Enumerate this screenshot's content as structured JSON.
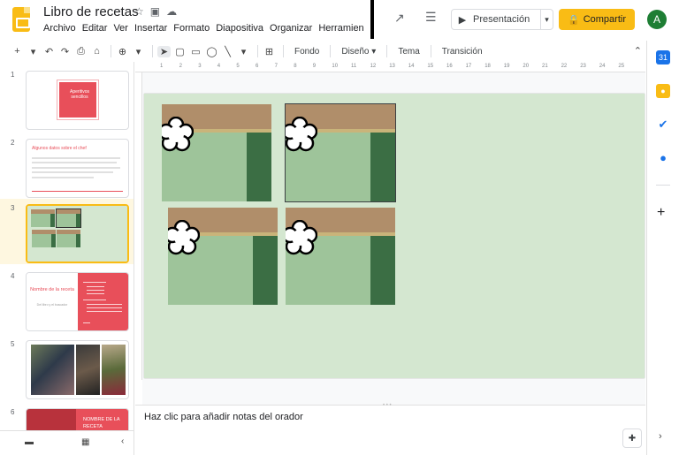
{
  "header": {
    "title": "Libro de recetas",
    "menu": [
      "Archivo",
      "Editar",
      "Ver",
      "Insertar",
      "Formato",
      "Diapositiva",
      "Organizar",
      "Herramien"
    ],
    "present_label": "Presentación",
    "share_label": "Compartir",
    "avatar_letter": "A"
  },
  "toolbar": {
    "fondo": "Fondo",
    "diseno": "Diseño",
    "tema": "Tema",
    "transicion": "Transición"
  },
  "filmstrip": {
    "slides": [
      {
        "number": "1",
        "title": "Aperitivos sencillos"
      },
      {
        "number": "2",
        "title": "Algunos datos sobre el chef"
      },
      {
        "number": "3"
      },
      {
        "number": "4",
        "title": "Nombre de la receta",
        "subtitle": "Del libro y el buscador"
      },
      {
        "number": "5"
      },
      {
        "number": "6",
        "title": "NOMBRE DE LA RECETA"
      }
    ]
  },
  "ruler": {
    "marks": [
      "1",
      "2",
      "3",
      "4",
      "5",
      "6",
      "7",
      "8",
      "9",
      "10",
      "11",
      "12",
      "13",
      "14",
      "15",
      "16",
      "17",
      "18",
      "19",
      "20",
      "21",
      "22",
      "23",
      "24",
      "25"
    ]
  },
  "notes": {
    "placeholder": "Haz clic para añadir notas del orador"
  },
  "colors": {
    "accent": "#f9bc15",
    "slide_bg": "#d4e7d0",
    "recipe_red": "#e84f5a"
  }
}
